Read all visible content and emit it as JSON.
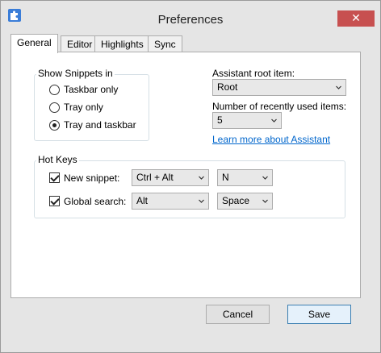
{
  "window": {
    "title": "Preferences",
    "close_glyph": "✕"
  },
  "tabs": [
    {
      "label": "General",
      "active": true
    },
    {
      "label": "Editor",
      "active": false
    },
    {
      "label": "Highlights",
      "active": false
    },
    {
      "label": "Sync",
      "active": false
    }
  ],
  "show_snippets": {
    "title": "Show Snippets in",
    "options": [
      {
        "label": "Taskbar only",
        "selected": false
      },
      {
        "label": "Tray only",
        "selected": false
      },
      {
        "label": "Tray and taskbar",
        "selected": true
      }
    ]
  },
  "assistant": {
    "root_label": "Assistant root item:",
    "root_value": "Root",
    "recent_label": "Number of recently used items:",
    "recent_value": "5",
    "learn_more": "Learn more about Assistant"
  },
  "hot_keys": {
    "title": "Hot Keys",
    "new_snippet": {
      "label": "New snippet:",
      "checked": true,
      "modifier": "Ctrl + Alt",
      "key": "N"
    },
    "global_search": {
      "label": "Global search:",
      "checked": true,
      "modifier": "Alt",
      "key": "Space"
    }
  },
  "buttons": {
    "cancel": "Cancel",
    "save": "Save"
  },
  "colors": {
    "close_button": "#c75050",
    "link": "#0066cc",
    "title_bar": "#e5e5e5",
    "app_icon": "#3a7dd8"
  },
  "icons": {
    "app": "puzzle-piece-icon",
    "close": "close-icon",
    "dropdown": "chevron-down-icon"
  }
}
